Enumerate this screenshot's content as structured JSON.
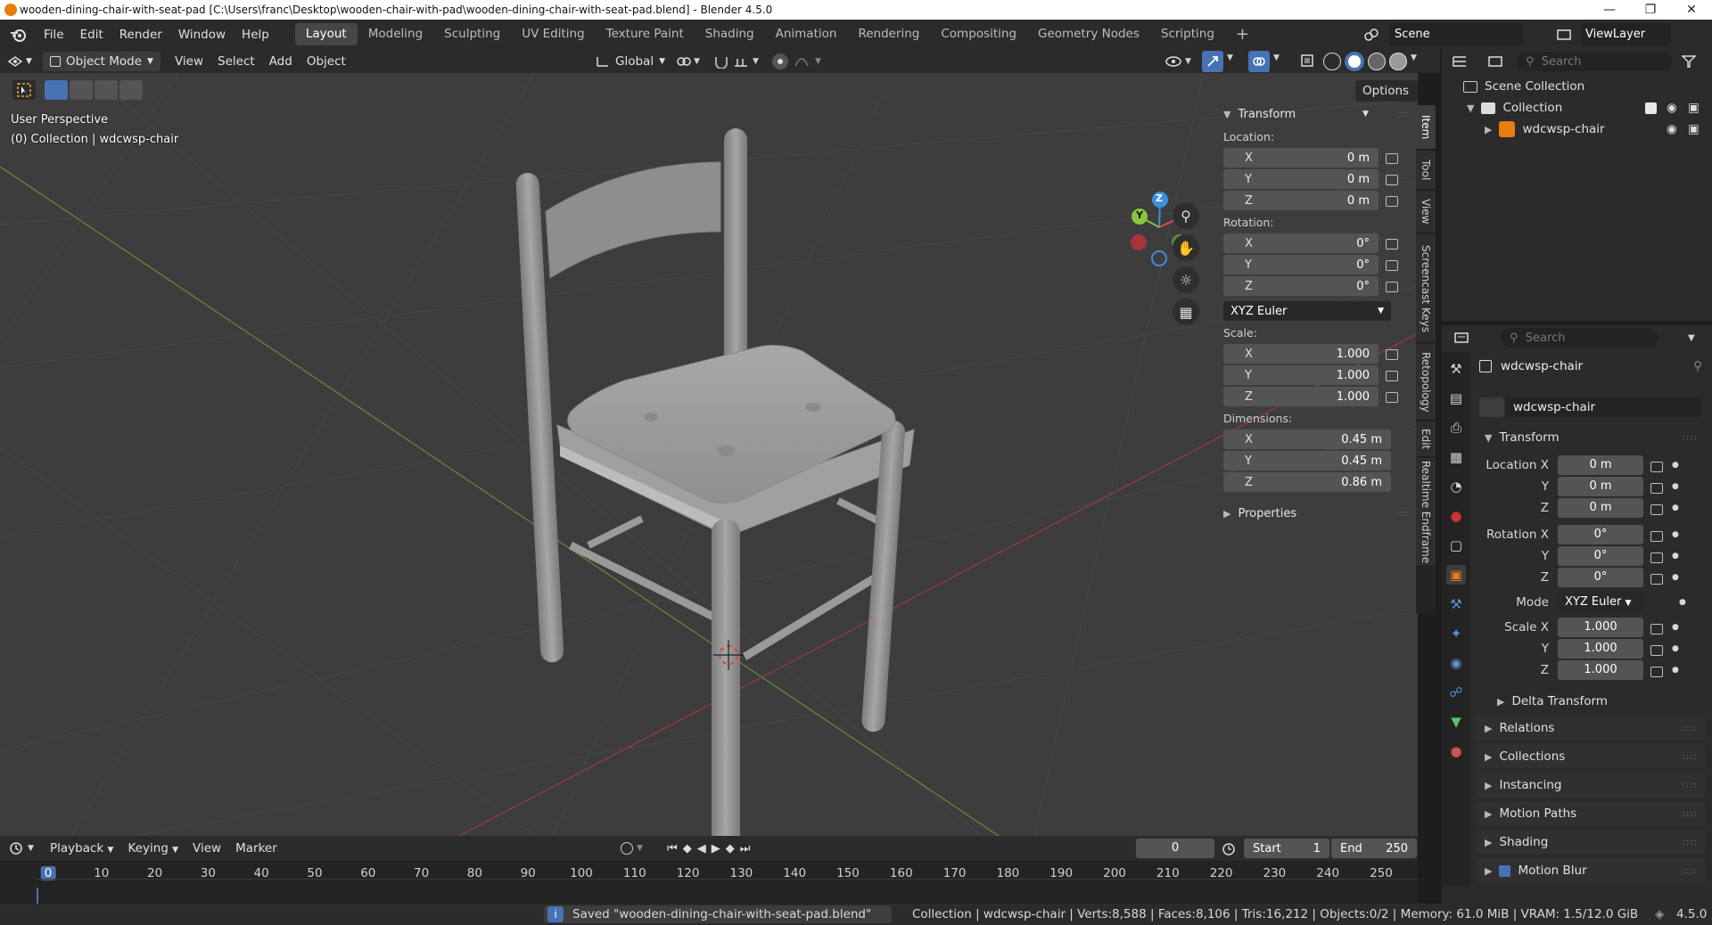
{
  "window": {
    "title": "wooden-dining-chair-with-seat-pad [C:\\Users\\franc\\Desktop\\wooden-chair-with-pad\\wooden-dining-chair-with-seat-pad.blend] - Blender 4.5.0"
  },
  "menus": [
    "File",
    "Edit",
    "Render",
    "Window",
    "Help"
  ],
  "workspaces": [
    "Layout",
    "Modeling",
    "Sculpting",
    "UV Editing",
    "Texture Paint",
    "Shading",
    "Animation",
    "Rendering",
    "Compositing",
    "Geometry Nodes",
    "Scripting"
  ],
  "active_workspace": "Layout",
  "scene": {
    "name": "Scene",
    "view_layer": "ViewLayer"
  },
  "viewport_header": {
    "mode": "Object Mode",
    "menus": [
      "View",
      "Select",
      "Add",
      "Object"
    ],
    "orientation": "Global",
    "options": "Options"
  },
  "viewport": {
    "perspective": "User Perspective",
    "context": "(0) Collection | wdcwsp-chair"
  },
  "gizmo": {
    "x": "X",
    "y": "Y",
    "z": "Z"
  },
  "npanel": {
    "title": "Transform",
    "location_label": "Location:",
    "rotation_label": "Rotation:",
    "scale_label": "Scale:",
    "dimensions_label": "Dimensions:",
    "location": [
      {
        "axis": "X",
        "value": "0 m"
      },
      {
        "axis": "Y",
        "value": "0 m"
      },
      {
        "axis": "Z",
        "value": "0 m"
      }
    ],
    "rotation": [
      {
        "axis": "X",
        "value": "0°"
      },
      {
        "axis": "Y",
        "value": "0°"
      },
      {
        "axis": "Z",
        "value": "0°"
      }
    ],
    "rotation_mode": "XYZ Euler",
    "scale": [
      {
        "axis": "X",
        "value": "1.000"
      },
      {
        "axis": "Y",
        "value": "1.000"
      },
      {
        "axis": "Z",
        "value": "1.000"
      }
    ],
    "dimensions": [
      {
        "axis": "X",
        "value": "0.45 m"
      },
      {
        "axis": "Y",
        "value": "0.45 m"
      },
      {
        "axis": "Z",
        "value": "0.86 m"
      }
    ],
    "properties": "Properties"
  },
  "sidebar_tabs": [
    "Item",
    "Tool",
    "View",
    "Screencast Keys",
    "Retopology",
    "Edit",
    "Realtime Endframe"
  ],
  "outliner": {
    "search_placeholder": "Search",
    "scene_collection": "Scene Collection",
    "collection": "Collection",
    "object": "wdcwsp-chair"
  },
  "properties": {
    "search_placeholder": "Search",
    "object_name": "wdcwsp-chair",
    "datablock": "wdcwsp-chair",
    "transform": "Transform",
    "location_label": "Location X",
    "rotation_label": "Rotation X",
    "mode_label": "Mode",
    "mode_value": "XYZ Euler",
    "scale_label": "Scale X",
    "location": [
      "0 m",
      "0 m",
      "0 m"
    ],
    "rotation": [
      "0°",
      "0°",
      "0°"
    ],
    "scale": [
      "1.000",
      "1.000",
      "1.000"
    ],
    "axis_y": "Y",
    "axis_z": "Z",
    "delta": "Delta Transform",
    "sections": [
      "Relations",
      "Collections",
      "Instancing",
      "Motion Paths",
      "Shading",
      "Motion Blur"
    ]
  },
  "timeline": {
    "menus": [
      "Playback",
      "Keying",
      "View",
      "Marker"
    ],
    "current_frame": "0",
    "start_label": "Start",
    "start": "1",
    "end_label": "End",
    "end": "250",
    "ticks": [
      "0",
      "10",
      "20",
      "30",
      "40",
      "50",
      "60",
      "70",
      "80",
      "90",
      "100",
      "110",
      "120",
      "130",
      "140",
      "150",
      "160",
      "170",
      "180",
      "190",
      "200",
      "210",
      "220",
      "230",
      "240",
      "250"
    ]
  },
  "status": {
    "message": "Saved \"wooden-dining-chair-with-seat-pad.blend\"",
    "info": "Collection | wdcwsp-chair | Verts:8,588 | Faces:8,106 | Tris:16,212 | Objects:0/2 | Memory: 61.0 MiB | VRAM: 1.5/12.0 GiB",
    "version": "4.5.0"
  },
  "colors": {
    "accent_blue": "#4772b3",
    "axis_x": "#e24a54",
    "axis_y": "#8ac43d",
    "axis_z": "#3e8ee0",
    "object_orange": "#e87d0d"
  }
}
